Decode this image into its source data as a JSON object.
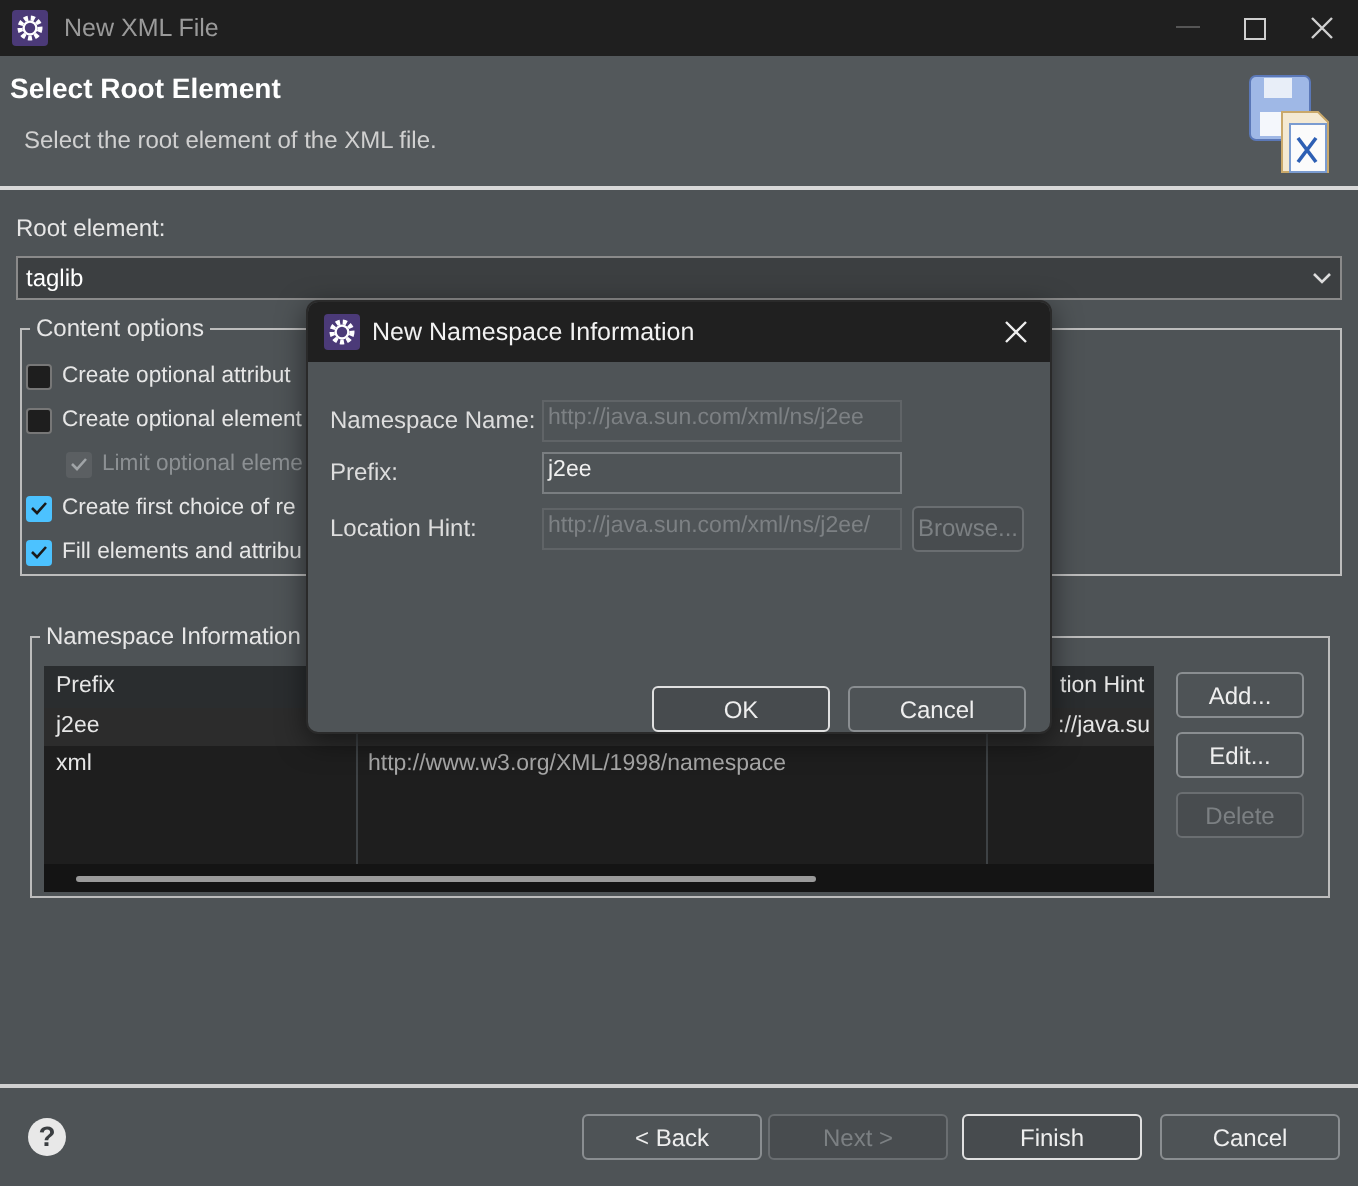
{
  "window": {
    "title": "New XML File"
  },
  "header": {
    "title": "Select Root Element",
    "description": "Select the root element of the XML file."
  },
  "root_element": {
    "label": "Root element:",
    "value": "taglib"
  },
  "content_options": {
    "label": "Content options",
    "options": [
      {
        "label": "Create optional attribut",
        "checked": false,
        "disabled": false
      },
      {
        "label": "Create optional element",
        "checked": false,
        "disabled": false,
        "children": [
          {
            "label": "Limit optional eleme",
            "checked": true,
            "disabled": true
          }
        ]
      },
      {
        "label": "Create first choice of re",
        "checked": true,
        "disabled": false
      },
      {
        "label": "Fill elements and attribu",
        "checked": true,
        "disabled": false
      }
    ]
  },
  "namespace_information": {
    "label": "Namespace Information",
    "columns": [
      {
        "heading": "Prefix"
      },
      {},
      {
        "heading": "tion Hint"
      }
    ],
    "rows": [
      {
        "cells": [
          "j2ee",
          null,
          "://java.su"
        ],
        "selected": true
      },
      {
        "cells": [
          "xml",
          "http://www.w3.org/XML/1998/namespace",
          null
        ],
        "selected": false
      }
    ],
    "buttons": [
      {
        "label": "Add...",
        "disabled": false
      },
      {
        "label": "Edit...",
        "disabled": false
      },
      {
        "label": "Delete",
        "disabled": true
      }
    ]
  },
  "help": {
    "glyph": "?"
  },
  "footer_buttons": [
    {
      "label": "< Back",
      "disabled": false,
      "default": false
    },
    {
      "label": "Next >",
      "disabled": true,
      "default": false
    },
    {
      "label": "Finish",
      "disabled": false,
      "default": true
    },
    {
      "label": "Cancel",
      "disabled": false,
      "default": false
    }
  ],
  "dialog": {
    "title": "New Namespace Information",
    "fields": [
      {
        "label": "Namespace Name:",
        "value": "http://java.sun.com/xml/ns/j2ee",
        "disabled": true
      },
      {
        "label": "Prefix:",
        "value": "j2ee",
        "disabled": false
      },
      {
        "label": "Location Hint:",
        "value": "http://java.sun.com/xml/ns/j2ee/",
        "disabled": true
      }
    ],
    "browse_button": {
      "label": "Browse...",
      "disabled": true
    },
    "buttons": [
      {
        "label": "OK",
        "default": true
      },
      {
        "label": "Cancel",
        "default": false
      }
    ]
  }
}
